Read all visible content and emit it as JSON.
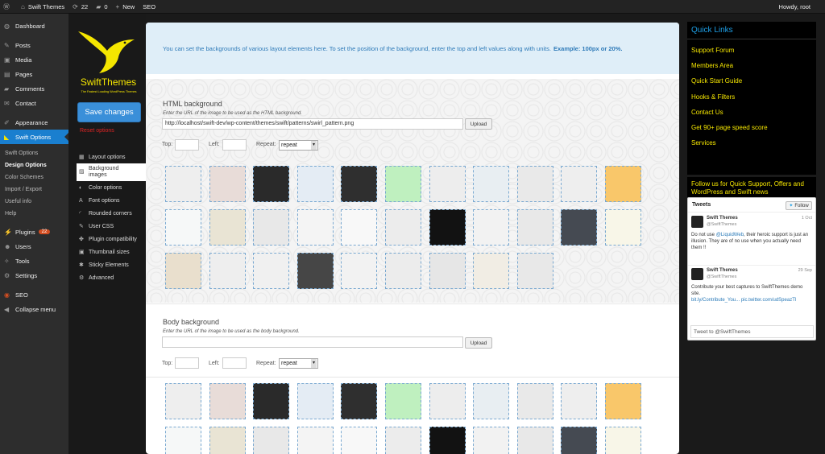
{
  "adminbar": {
    "site": "Swift Themes",
    "updates": "22",
    "comments": "0",
    "new": "New",
    "seo": "SEO",
    "howdy": "Howdy, root"
  },
  "sidebar": {
    "dashboard": "Dashboard",
    "posts": "Posts",
    "media": "Media",
    "pages": "Pages",
    "comments": "Comments",
    "contact": "Contact",
    "appearance": "Appearance",
    "swift_options": "Swift Options",
    "subitems": [
      "Swift Options",
      "Design Options",
      "Color Schemes",
      "Import / Export",
      "Useful info",
      "Help"
    ],
    "plugins": "Plugins",
    "plugins_badge": "22",
    "users": "Users",
    "tools": "Tools",
    "settings": "Settings",
    "seo": "SEO",
    "collapse": "Collapse menu"
  },
  "options": {
    "logo_brand": "SwiftThemes",
    "logo_tagline": "The Fastest Loading WordPress Themes",
    "save_label": "Save changes",
    "reset_label": "Reset options",
    "nav": [
      "Layout options",
      "Background images",
      "Color options",
      "Font options",
      "Rounded corners",
      "User CSS",
      "Plugin compatibility",
      "Thumbnail sizes",
      "Sticky Elements",
      "Advanced"
    ]
  },
  "notice": {
    "text": "You can set the backgrounds of various layout elements here. To set the position of the background, enter the top and left values along with units.",
    "example": "Example: 100px or 20%."
  },
  "html_bg": {
    "title": "HTML background",
    "desc": "Enter the URL of the image to be used as the HTML background.",
    "url": "http://localhost/swift-dev/wp-content/themes/swift/patterns/swirl_pattern.png",
    "upload": "Upload",
    "top": "Top:",
    "left": "Left:",
    "repeat_label": "Repeat:",
    "repeat": "repeat"
  },
  "body_bg": {
    "title": "Body background",
    "desc": "Enter the URL of the image to be used as the body background.",
    "url": "",
    "upload": "Upload",
    "top": "Top:",
    "left": "Left:",
    "repeat_label": "Repeat:",
    "repeat": "repeat"
  },
  "patterns": {
    "colors": [
      "#eeeeee",
      "#e8dcd8",
      "#2a2a2a",
      "#e4ecf4",
      "#2f2f2f",
      "#bff0bf",
      "#ededed",
      "#e8eef2",
      "#e9e9e9",
      "#eeeeee",
      "#f9c76a",
      "#f6f8f8",
      "#e9e4d4",
      "#e8e8e8",
      "#f4f4f4",
      "#f8f8f8",
      "#ececec",
      "#121212",
      "#f2f2f2",
      "#e8e8e8",
      "#454a52",
      "#f8f6e8",
      "#e9dfcd",
      "#eeeeee",
      "#f0f0f0",
      "#464646",
      "#f2f2f2",
      "#ececec",
      "#e6e6e6",
      "#f1ede4",
      "#e8e8e8"
    ]
  },
  "right": {
    "quick_links_title": "Quick Links",
    "quick_links": [
      "Support Forum",
      "Members Area",
      "Quick Start Guide",
      "Hooks & Filters",
      "Contact Us",
      "Get 90+ page speed score",
      "Services"
    ],
    "follow_text": "Follow us for Quick Support, Offers and WordPress and Swift news",
    "tweets_title": "Tweets",
    "follow_btn": "Follow",
    "tweets": [
      {
        "name": "Swift Themes",
        "handle": "@SwiftThemes",
        "date": "1 Oct",
        "text": "Do not use",
        "link": "@LiquidWeb",
        "rest": ", their heroic support is just an illusion. They are of no use when you actually need them !!"
      },
      {
        "name": "Swift Themes",
        "handle": "@SwiftThemes",
        "date": "29 Sep",
        "text": "Contribute your best captures to SwiftThemes demo site.",
        "link": "bit.ly/Contribute_You...",
        "rest": "pic.twitter.com/udSpeazTI"
      }
    ],
    "reply": "Tweet to @SwiftThemes"
  }
}
